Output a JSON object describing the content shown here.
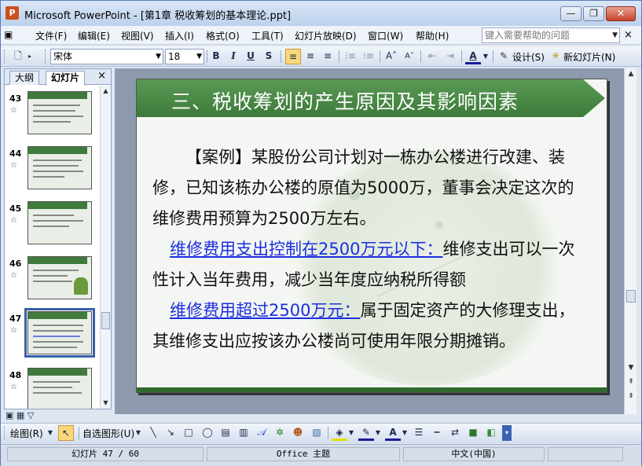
{
  "window": {
    "title": "Microsoft PowerPoint - [第1章 税收筹划的基本理论.ppt]",
    "minimize": "—",
    "restore": "❐",
    "close": "✕"
  },
  "menu": {
    "items": [
      "文件(F)",
      "编辑(E)",
      "视图(V)",
      "插入(I)",
      "格式(O)",
      "工具(T)",
      "幻灯片放映(D)",
      "窗口(W)",
      "帮助(H)"
    ],
    "help_placeholder": "键入需要帮助的问题",
    "doc_close": "×"
  },
  "toolbar": {
    "font_name": "宋体",
    "font_size": "18",
    "bold": "B",
    "italic": "I",
    "underline": "U",
    "shadow": "S",
    "design_label": "设计(S)",
    "new_slide_label": "新幻灯片(N)"
  },
  "left_pane": {
    "tabs": [
      "大纲",
      "幻灯片"
    ],
    "active_tab": "幻灯片",
    "close": "×",
    "thumbnails": [
      {
        "number": "43"
      },
      {
        "number": "44"
      },
      {
        "number": "45"
      },
      {
        "number": "46"
      },
      {
        "number": "47",
        "selected": true
      },
      {
        "number": "48"
      }
    ]
  },
  "slide": {
    "title": "三、税收筹划的产生原因及其影响因素",
    "paragraph1": "【案例】某股份公司计划对一栋办公楼进行改建、装修，已知该栋办公楼的原值为5000万，董事会决定这次的维修费用预算为2500万左右。",
    "link1": "维修费用支出控制在2500万元以下：",
    "text1": "维修支出可以一次性计入当年费用，减少当年度应纳税所得额",
    "link2": "维修费用超过2500万元：",
    "text2": "属于固定资产的大修理支出，其维修支出应按该办公楼尚可使用年限分期摊销。",
    "accent_green": "#4a8a45",
    "link_color": "#1a2fe0"
  },
  "drawing_toolbar": {
    "draw_label": "绘图(R)",
    "autoshapes_label": "自选图形(U)"
  },
  "status": {
    "slide_counter": "幻灯片 47 / 60",
    "theme": "Office 主题",
    "language": "中文(中国)"
  }
}
